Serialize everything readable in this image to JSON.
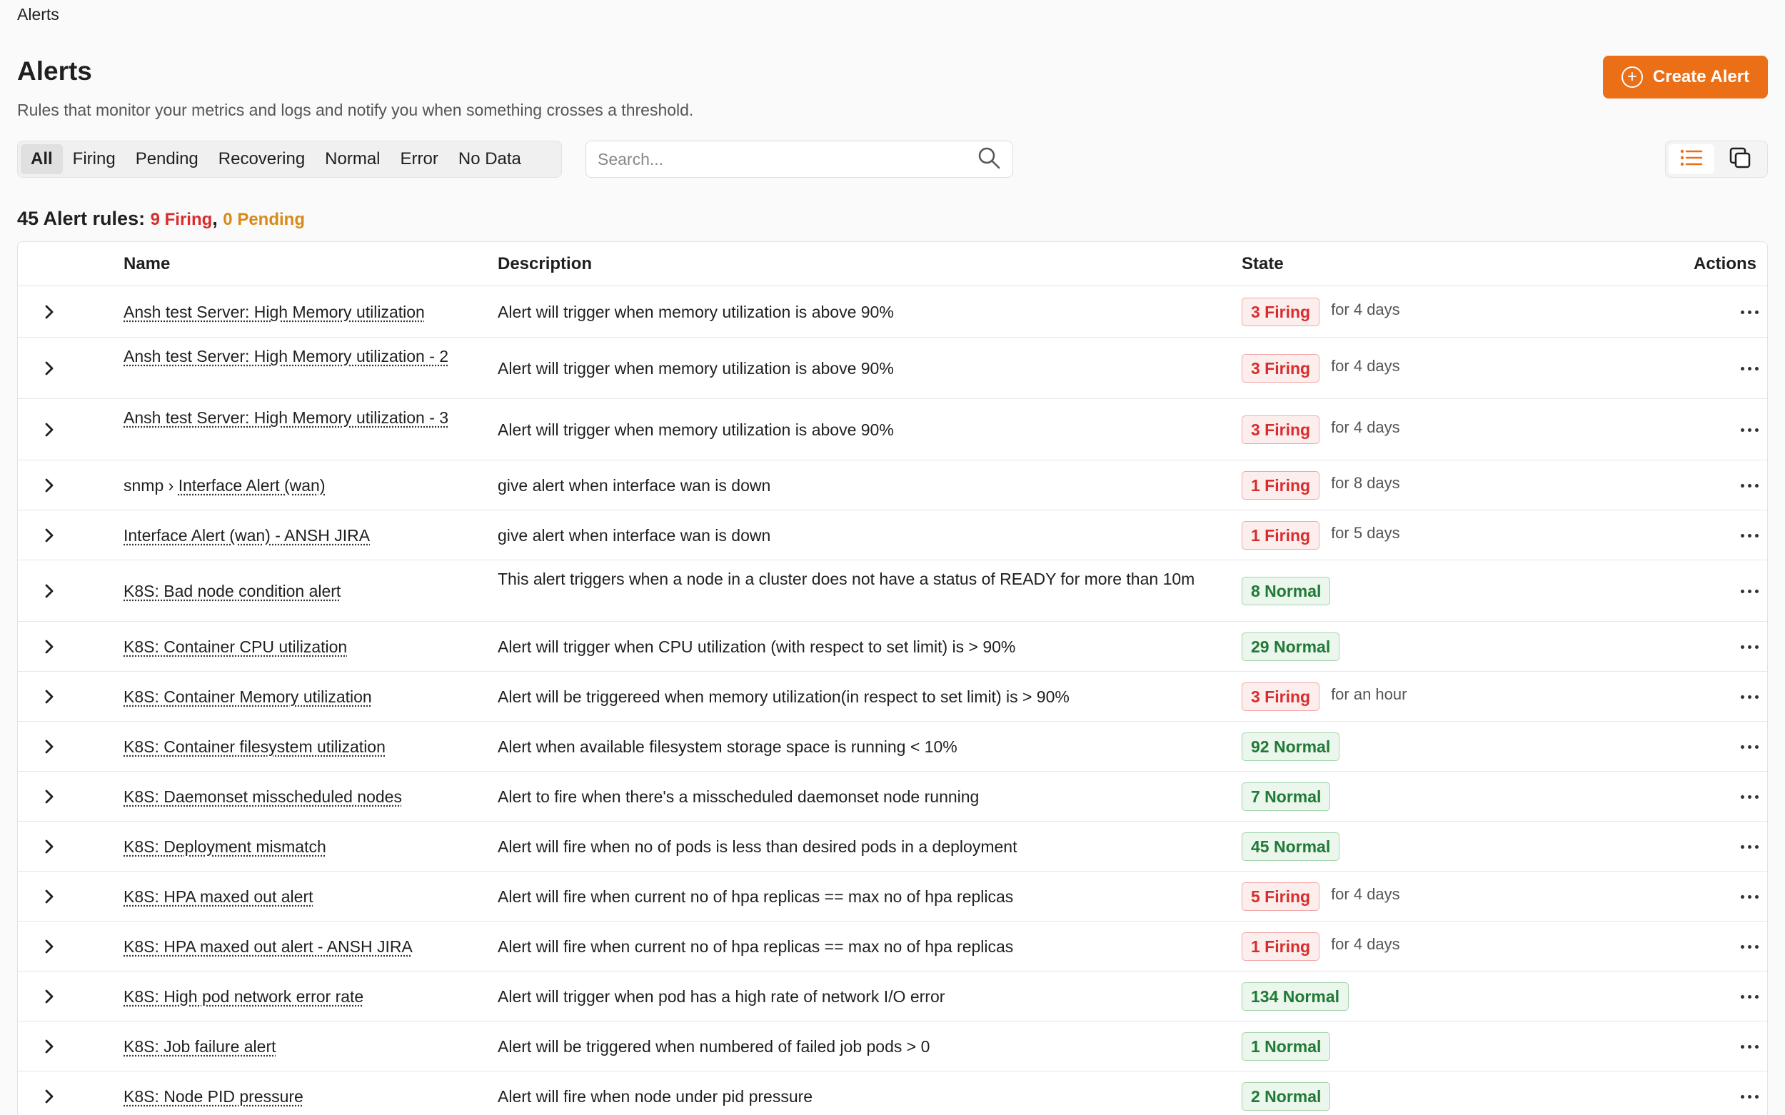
{
  "breadcrumb": "Alerts",
  "title": "Alerts",
  "subtitle": "Rules that monitor your metrics and logs and notify you when something crosses a threshold.",
  "create_button": "Create Alert",
  "filters": [
    "All",
    "Firing",
    "Pending",
    "Recovering",
    "Normal",
    "Error",
    "No Data"
  ],
  "active_filter": "All",
  "search": {
    "placeholder": "Search..."
  },
  "summary": {
    "prefix": "45 Alert rules:",
    "firing": "9 Firing",
    "separator": ",",
    "pending": "0 Pending"
  },
  "columns": {
    "name": "Name",
    "description": "Description",
    "state": "State",
    "actions": "Actions"
  },
  "colors": {
    "accent": "#ea6f16",
    "firing": "#d92c2c",
    "normal": "#1f7a35",
    "pending": "#d98a16"
  },
  "rows": [
    {
      "prefix": "",
      "name": "Ansh test Server: High Memory utilization",
      "description": "Alert will trigger when memory utilization is above 90%",
      "state": "3 Firing",
      "kind": "firing",
      "duration": "for 4 days"
    },
    {
      "prefix": "",
      "name": "Ansh test Server: High Memory utilization - 2",
      "description": "Alert will trigger when memory utilization is above 90%",
      "state": "3 Firing",
      "kind": "firing",
      "duration": "for 4 days"
    },
    {
      "prefix": "",
      "name": "Ansh test Server: High Memory utilization - 3",
      "description": "Alert will trigger when memory utilization is above 90%",
      "state": "3 Firing",
      "kind": "firing",
      "duration": "for 4 days"
    },
    {
      "prefix": "snmp › ",
      "name": "Interface Alert (wan)",
      "description": "give alert when interface wan is down",
      "state": "1 Firing",
      "kind": "firing",
      "duration": "for 8 days"
    },
    {
      "prefix": "",
      "name": "Interface Alert (wan) - ANSH JIRA",
      "description": "give alert when interface wan is down",
      "state": "1 Firing",
      "kind": "firing",
      "duration": "for 5 days"
    },
    {
      "prefix": "",
      "name": "K8S: Bad node condition alert",
      "description": "This alert triggers when a node in a cluster does not have a status of READY for more than 10m",
      "state": "8 Normal",
      "kind": "normal",
      "duration": ""
    },
    {
      "prefix": "",
      "name": "K8S: Container CPU utilization",
      "description": "Alert will trigger when CPU utilization (with respect to set limit) is > 90%",
      "state": "29 Normal",
      "kind": "normal",
      "duration": ""
    },
    {
      "prefix": "",
      "name": "K8S: Container Memory utilization",
      "description": "Alert will be triggereed when memory utilization(in respect to set limit) is > 90%",
      "state": "3 Firing",
      "kind": "firing",
      "duration": "for an hour"
    },
    {
      "prefix": "",
      "name": "K8S: Container filesystem utilization",
      "description": "Alert when available filesystem storage space is running < 10%",
      "state": "92 Normal",
      "kind": "normal",
      "duration": ""
    },
    {
      "prefix": "",
      "name": "K8S: Daemonset misscheduled nodes",
      "description": "Alert to fire when there's a misscheduled daemonset node running",
      "state": "7 Normal",
      "kind": "normal",
      "duration": ""
    },
    {
      "prefix": "",
      "name": "K8S: Deployment mismatch",
      "description": "Alert will fire when no of pods is less than desired pods in a deployment",
      "state": "45 Normal",
      "kind": "normal",
      "duration": ""
    },
    {
      "prefix": "",
      "name": "K8S: HPA maxed out alert",
      "description": "Alert will fire when current no of hpa replicas == max no of hpa replicas",
      "state": "5 Firing",
      "kind": "firing",
      "duration": "for 4 days"
    },
    {
      "prefix": "",
      "name": "K8S: HPA maxed out alert - ANSH JIRA",
      "description": "Alert will fire when current no of hpa replicas == max no of hpa replicas",
      "state": "1 Firing",
      "kind": "firing",
      "duration": "for 4 days"
    },
    {
      "prefix": "",
      "name": "K8S: High pod network error rate",
      "description": "Alert will trigger when pod has a high rate of network I/O error",
      "state": "134 Normal",
      "kind": "normal",
      "duration": ""
    },
    {
      "prefix": "",
      "name": "K8S: Job failure alert",
      "description": "Alert will be triggered when numbered of failed job pods > 0",
      "state": "1 Normal",
      "kind": "normal",
      "duration": ""
    },
    {
      "prefix": "",
      "name": "K8S: Node PID pressure",
      "description": "Alert will fire when node under pid pressure",
      "state": "2 Normal",
      "kind": "normal",
      "duration": ""
    }
  ]
}
